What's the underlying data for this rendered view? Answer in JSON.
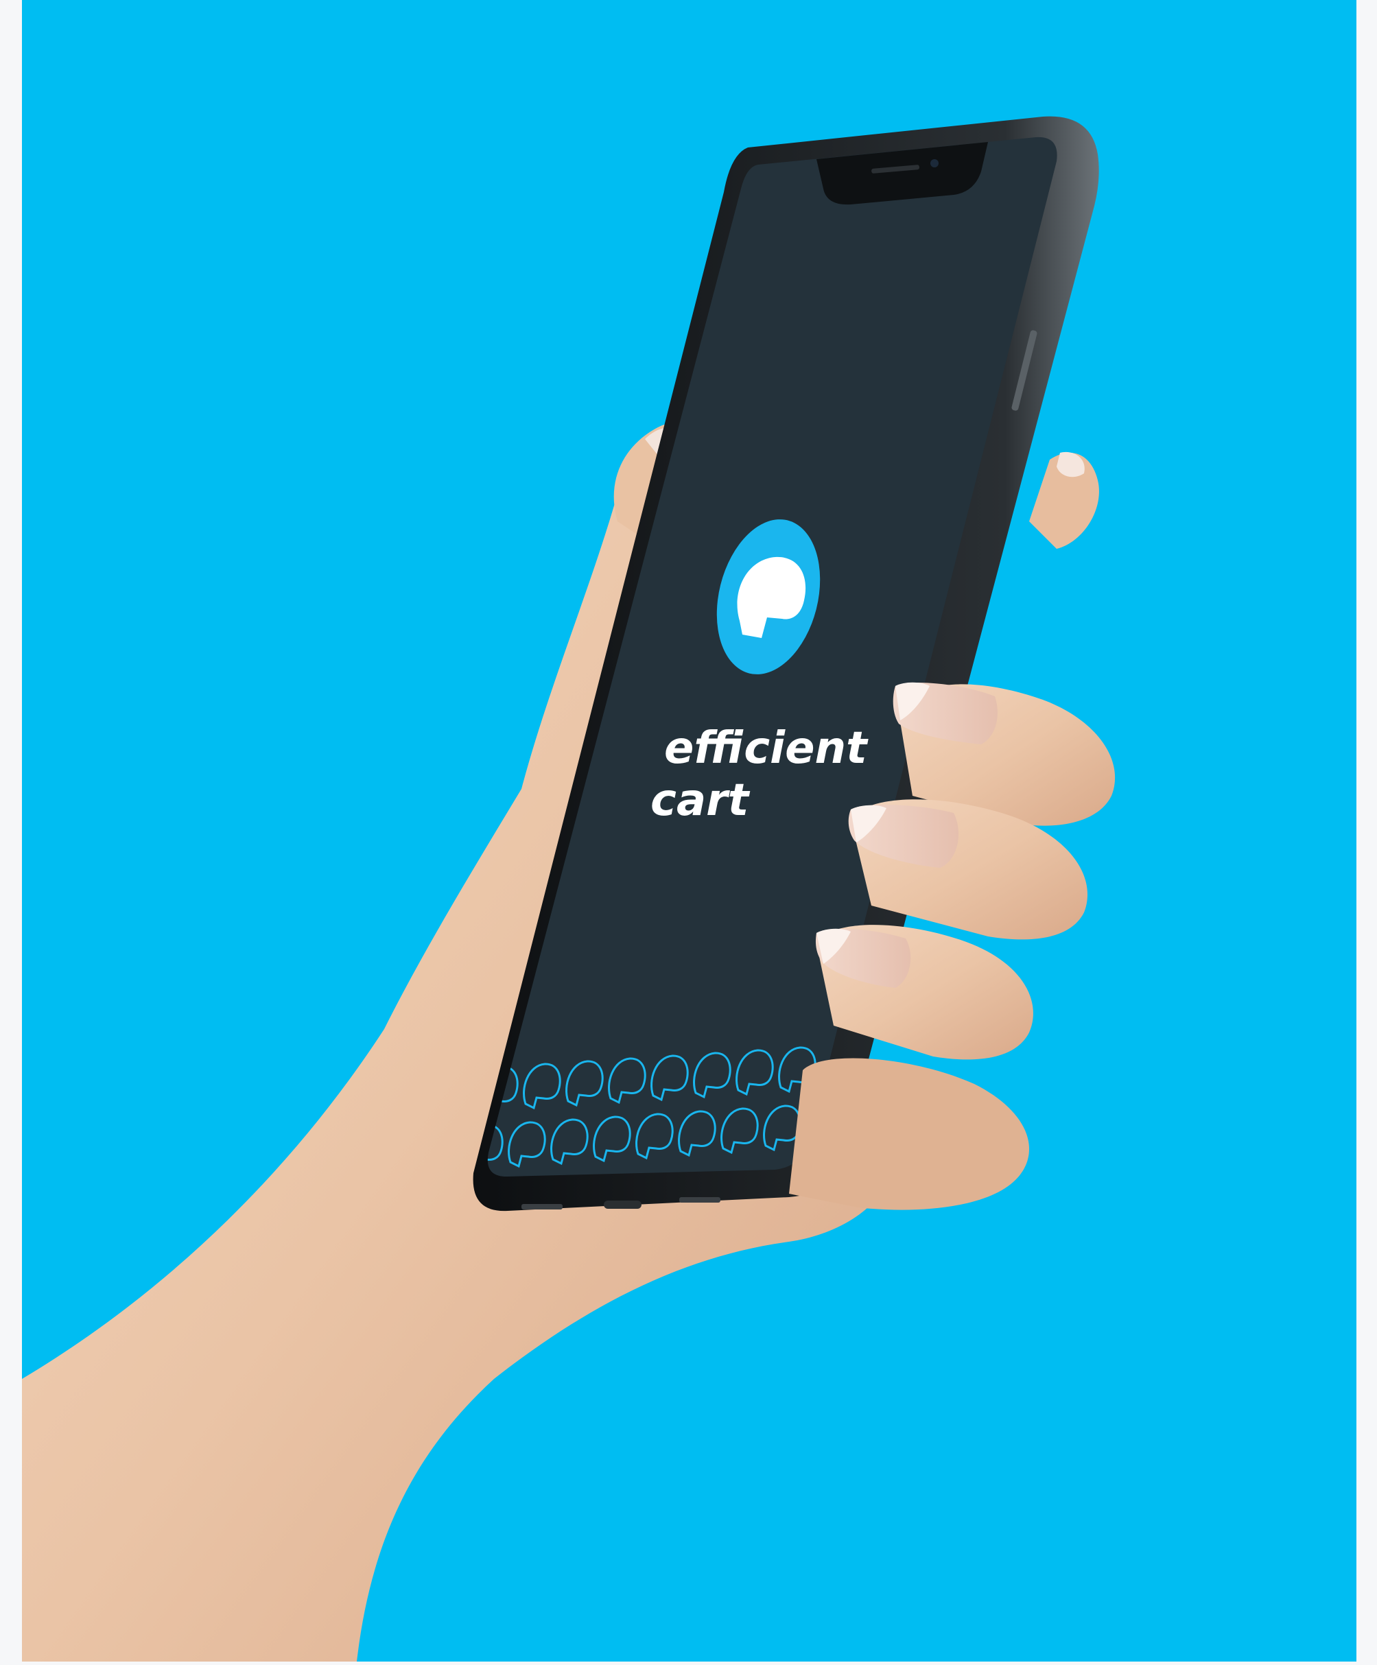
{
  "scene": {
    "description_colors": {
      "page_border": "#f6f7f9",
      "backdrop": "#00bdf2",
      "phone_screen": "#24323b",
      "phone_frame": "#16191c",
      "brand_blue": "#1ab6ee",
      "skin": "#ecc9ad"
    }
  },
  "app": {
    "brand_line_1": "efficient",
    "brand_line_2": "cart",
    "logo_icon": "cart-bubble-icon",
    "pattern_icon": "outline-cart-bubble-icon"
  }
}
